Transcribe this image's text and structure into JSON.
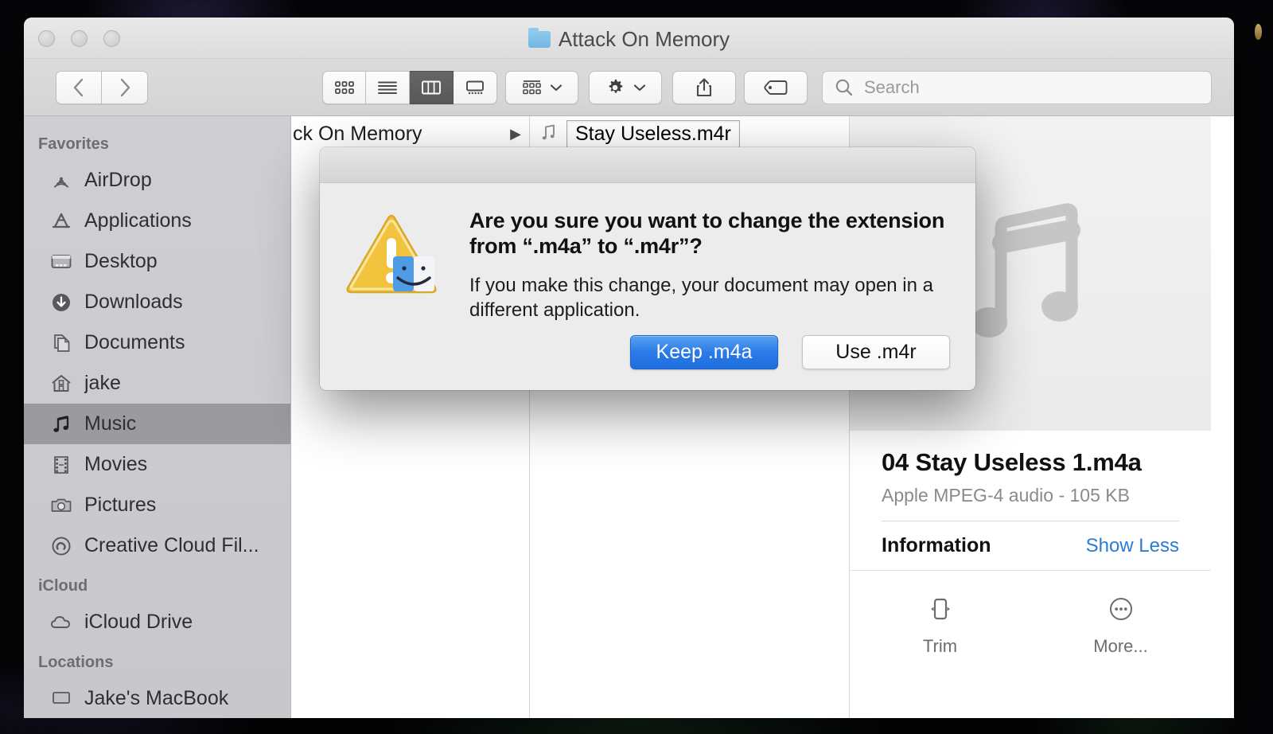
{
  "window": {
    "title": "Attack On Memory",
    "title_icon": "folder-icon",
    "traffic_lights": [
      "close-button",
      "minimize-button",
      "maximize-button"
    ]
  },
  "toolbar": {
    "back_icon": "chevron-left-icon",
    "forward_icon": "chevron-right-icon",
    "view_modes": [
      {
        "name": "icon-view",
        "icon": "grid-icon",
        "active": false
      },
      {
        "name": "list-view",
        "icon": "list-icon",
        "active": false
      },
      {
        "name": "column-view",
        "icon": "columns-icon",
        "active": true
      },
      {
        "name": "gallery-view",
        "icon": "gallery-icon",
        "active": false
      }
    ],
    "arrange_icon": "arrange-grid-icon",
    "action_icon": "gear-icon",
    "share_icon": "share-icon",
    "tags_icon": "tag-icon",
    "dropdown_icon": "chevron-down-icon"
  },
  "search": {
    "placeholder": "Search",
    "value": "",
    "icon": "search-icon"
  },
  "sidebar": {
    "sections": [
      {
        "header": "Favorites",
        "items": [
          {
            "label": "AirDrop",
            "icon": "airdrop-icon",
            "selected": false
          },
          {
            "label": "Applications",
            "icon": "applications-icon",
            "selected": false
          },
          {
            "label": "Desktop",
            "icon": "desktop-icon",
            "selected": false
          },
          {
            "label": "Downloads",
            "icon": "downloads-icon",
            "selected": false
          },
          {
            "label": "Documents",
            "icon": "documents-icon",
            "selected": false
          },
          {
            "label": "jake",
            "icon": "home-icon",
            "selected": false
          },
          {
            "label": "Music",
            "icon": "music-note-icon",
            "selected": true
          },
          {
            "label": "Movies",
            "icon": "film-icon",
            "selected": false
          },
          {
            "label": "Pictures",
            "icon": "camera-icon",
            "selected": false
          },
          {
            "label": "Creative Cloud Fil...",
            "icon": "creative-cloud-icon",
            "selected": false
          }
        ]
      },
      {
        "header": "iCloud",
        "items": [
          {
            "label": "iCloud Drive",
            "icon": "cloud-icon",
            "selected": false
          }
        ]
      },
      {
        "header": "Locations",
        "items": [
          {
            "label": "Jake's MacBook",
            "icon": "laptop-icon",
            "selected": false
          }
        ]
      }
    ]
  },
  "columns": {
    "folder_row": {
      "label": "ck On Memory",
      "chevron": "▶"
    },
    "file_row": {
      "icon": "music-note-icon",
      "editing_value": "Stay Useless.m4r"
    }
  },
  "preview": {
    "artwork_icon": "music-note-icon",
    "file_name": "04 Stay Useless 1.m4a",
    "file_kind": "Apple MPEG-4 audio - 105 KB",
    "info_title": "Information",
    "show_toggle": "Show Less",
    "actions": [
      {
        "label": "Trim",
        "icon": "trim-icon"
      },
      {
        "label": "More...",
        "icon": "more-circle-icon"
      }
    ]
  },
  "dialog": {
    "icon": "warning-finder-icon",
    "heading": "Are you sure you want to change the extension from “.m4a” to “.m4r”?",
    "message": "If you make this change, your document may open in a different application.",
    "buttons": [
      {
        "label": "Keep .m4a",
        "style": "primary"
      },
      {
        "label": "Use .m4r",
        "style": "secondary"
      }
    ]
  },
  "colors": {
    "accent_blue": "#2b7ae8",
    "link_blue": "#2b7bd6",
    "warning_yellow": "#f0c03a",
    "sidebar_bg": "#cacace",
    "selected_row": "#9b9b9f"
  }
}
